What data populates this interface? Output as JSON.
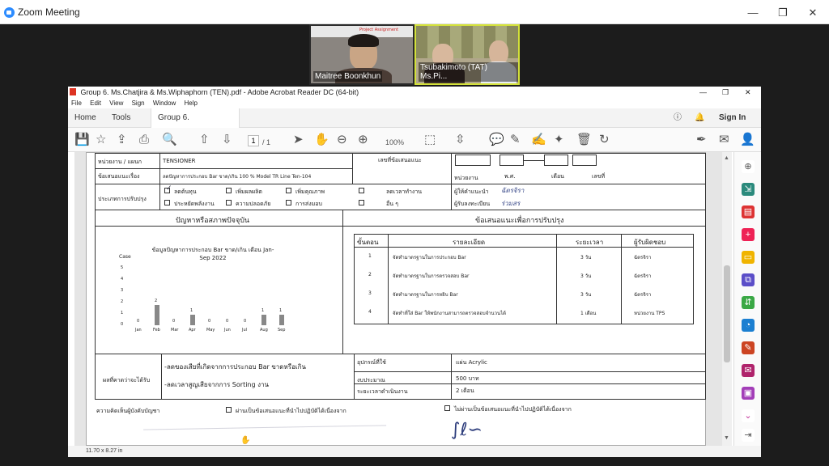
{
  "zoom": {
    "window_title": "Zoom Meeting"
  },
  "videos": [
    {
      "name": "Maitree Boonkhun",
      "slide_text": "Project Assignment"
    },
    {
      "name": "Tsubakimoto (TAT) Ms.Pi..."
    }
  ],
  "acrobat": {
    "title": "Group 6. Ms.Chatjira & Ms.Wiphaphorn (TEN).pdf - Adobe Acrobat Reader DC (64-bit)",
    "menu": [
      "File",
      "Edit",
      "View",
      "Sign",
      "Window",
      "Help"
    ],
    "tabs": {
      "home": "Home",
      "tools": "Tools",
      "doc": "Group 6. Ms.Chatjir..."
    },
    "sign_in": "Sign In",
    "page_current": "1",
    "page_total": "/ 1",
    "zoom": "100%",
    "status_size": "11.70 x 8.27 in"
  },
  "form": {
    "dept_label": "หน่วยงาน / แผนก",
    "dept_value": "TENSIONER",
    "topic_label": "ข้อเสนอแนะเรื่อง",
    "topic_value": "ลดปัญหาการประกอบ Bar ขาด/เกิน 100 % Model TR Line Ten-104",
    "suggest_no_label": "เลขที่ข้อเสนอแนะ",
    "unit_label": "หน่วยงาน",
    "year_label": "พ.ศ.",
    "month_label": "เดือน",
    "no_label": "เลขที่",
    "type_label": "ประเภทการปรับปรุง",
    "opt1": "ลดต้นทุน",
    "opt2": "เพิ่มผลผลิต",
    "opt3": "เพิ่มคุณภาพ",
    "opt4": "ลดเวลาทำงาน",
    "opt5": "ประหยัดพลังงาน",
    "opt6": "ความปลอดภัย",
    "opt7": "การส่งมอบ",
    "opt8": "อื่น ๆ",
    "proposer_label": "ผู้ให้คำแนะนำ",
    "register_label": "ผู้รับลงทะเบียน",
    "problem_header": "ปัญหาหรือสภาพปัจจุบัน",
    "suggest_header": "ข้อเสนอแนะเพื่อการปรับปรุง",
    "steps_header": [
      "ขั้นตอน",
      "รายละเอียด",
      "ระยะเวลา",
      "ผู้รับผิดชอบ"
    ],
    "steps": [
      {
        "no": "1",
        "detail": "จัดทำมาตรฐานในการประกอบ Bar",
        "time": "3 วัน",
        "owner": "ฉัตรจิรา"
      },
      {
        "no": "2",
        "detail": "จัดทำมาตรฐานในการตรวจสอบ Bar",
        "time": "3 วัน",
        "owner": "ฉัตรจิรา"
      },
      {
        "no": "3",
        "detail": "จัดทำมาตรฐานในการหยิบ Bar",
        "time": "3 วัน",
        "owner": "ฉัตรจิรา"
      },
      {
        "no": "4",
        "detail": "จัดทำที่ใส่ Bar ให้พนักงานสามารถตรวจสอบจำนวนได้",
        "time": "1 เดือน",
        "owner": "หน่วยงาน TPS"
      }
    ],
    "expected_label": "ผลที่คาดว่าจะได้รับ",
    "expected1": "-ลดของเสียที่เกิดจากการประกอบ Bar ขาดหรือเกิน",
    "expected2": "-ลดเวลาสูญเสียจากการ Sorting งาน",
    "equip_label": "อุปกรณ์ที่ใช้",
    "equip_value": "แผ่น Acrylic",
    "budget_label": "งบประมาณ",
    "budget_value": "500 บาท",
    "duration_label": "ระยะเวลาดำเนินงาน",
    "duration_value": "2 เดือน",
    "approval_label": "ความคิดเห็นผู้บังคับบัญชา",
    "approve_yes": "ผ่านเป็นข้อเสนอแนะที่นำไปปฏิบัติได้เนื่องจาก",
    "approve_no": "ไม่ผ่านเป็นข้อเสนอแนะที่นำไปปฏิบัติได้เนื่องจาก"
  },
  "chart_data": {
    "type": "bar",
    "title": "ข้อมูลปัญหาการประกอบ Bar ขาด/เกิน เดือน Jan-Sep 2022",
    "ylabel": "Case",
    "categories": [
      "Jan",
      "Feb",
      "Mar",
      "Apr",
      "May",
      "Jun",
      "Jul",
      "Aug",
      "Sep"
    ],
    "values": [
      0,
      2,
      0,
      1,
      0,
      0,
      0,
      1,
      1
    ],
    "ylim": [
      0,
      5
    ],
    "yticks": [
      "0",
      "1",
      "2",
      "3",
      "4",
      "5"
    ],
    "grid": false
  }
}
